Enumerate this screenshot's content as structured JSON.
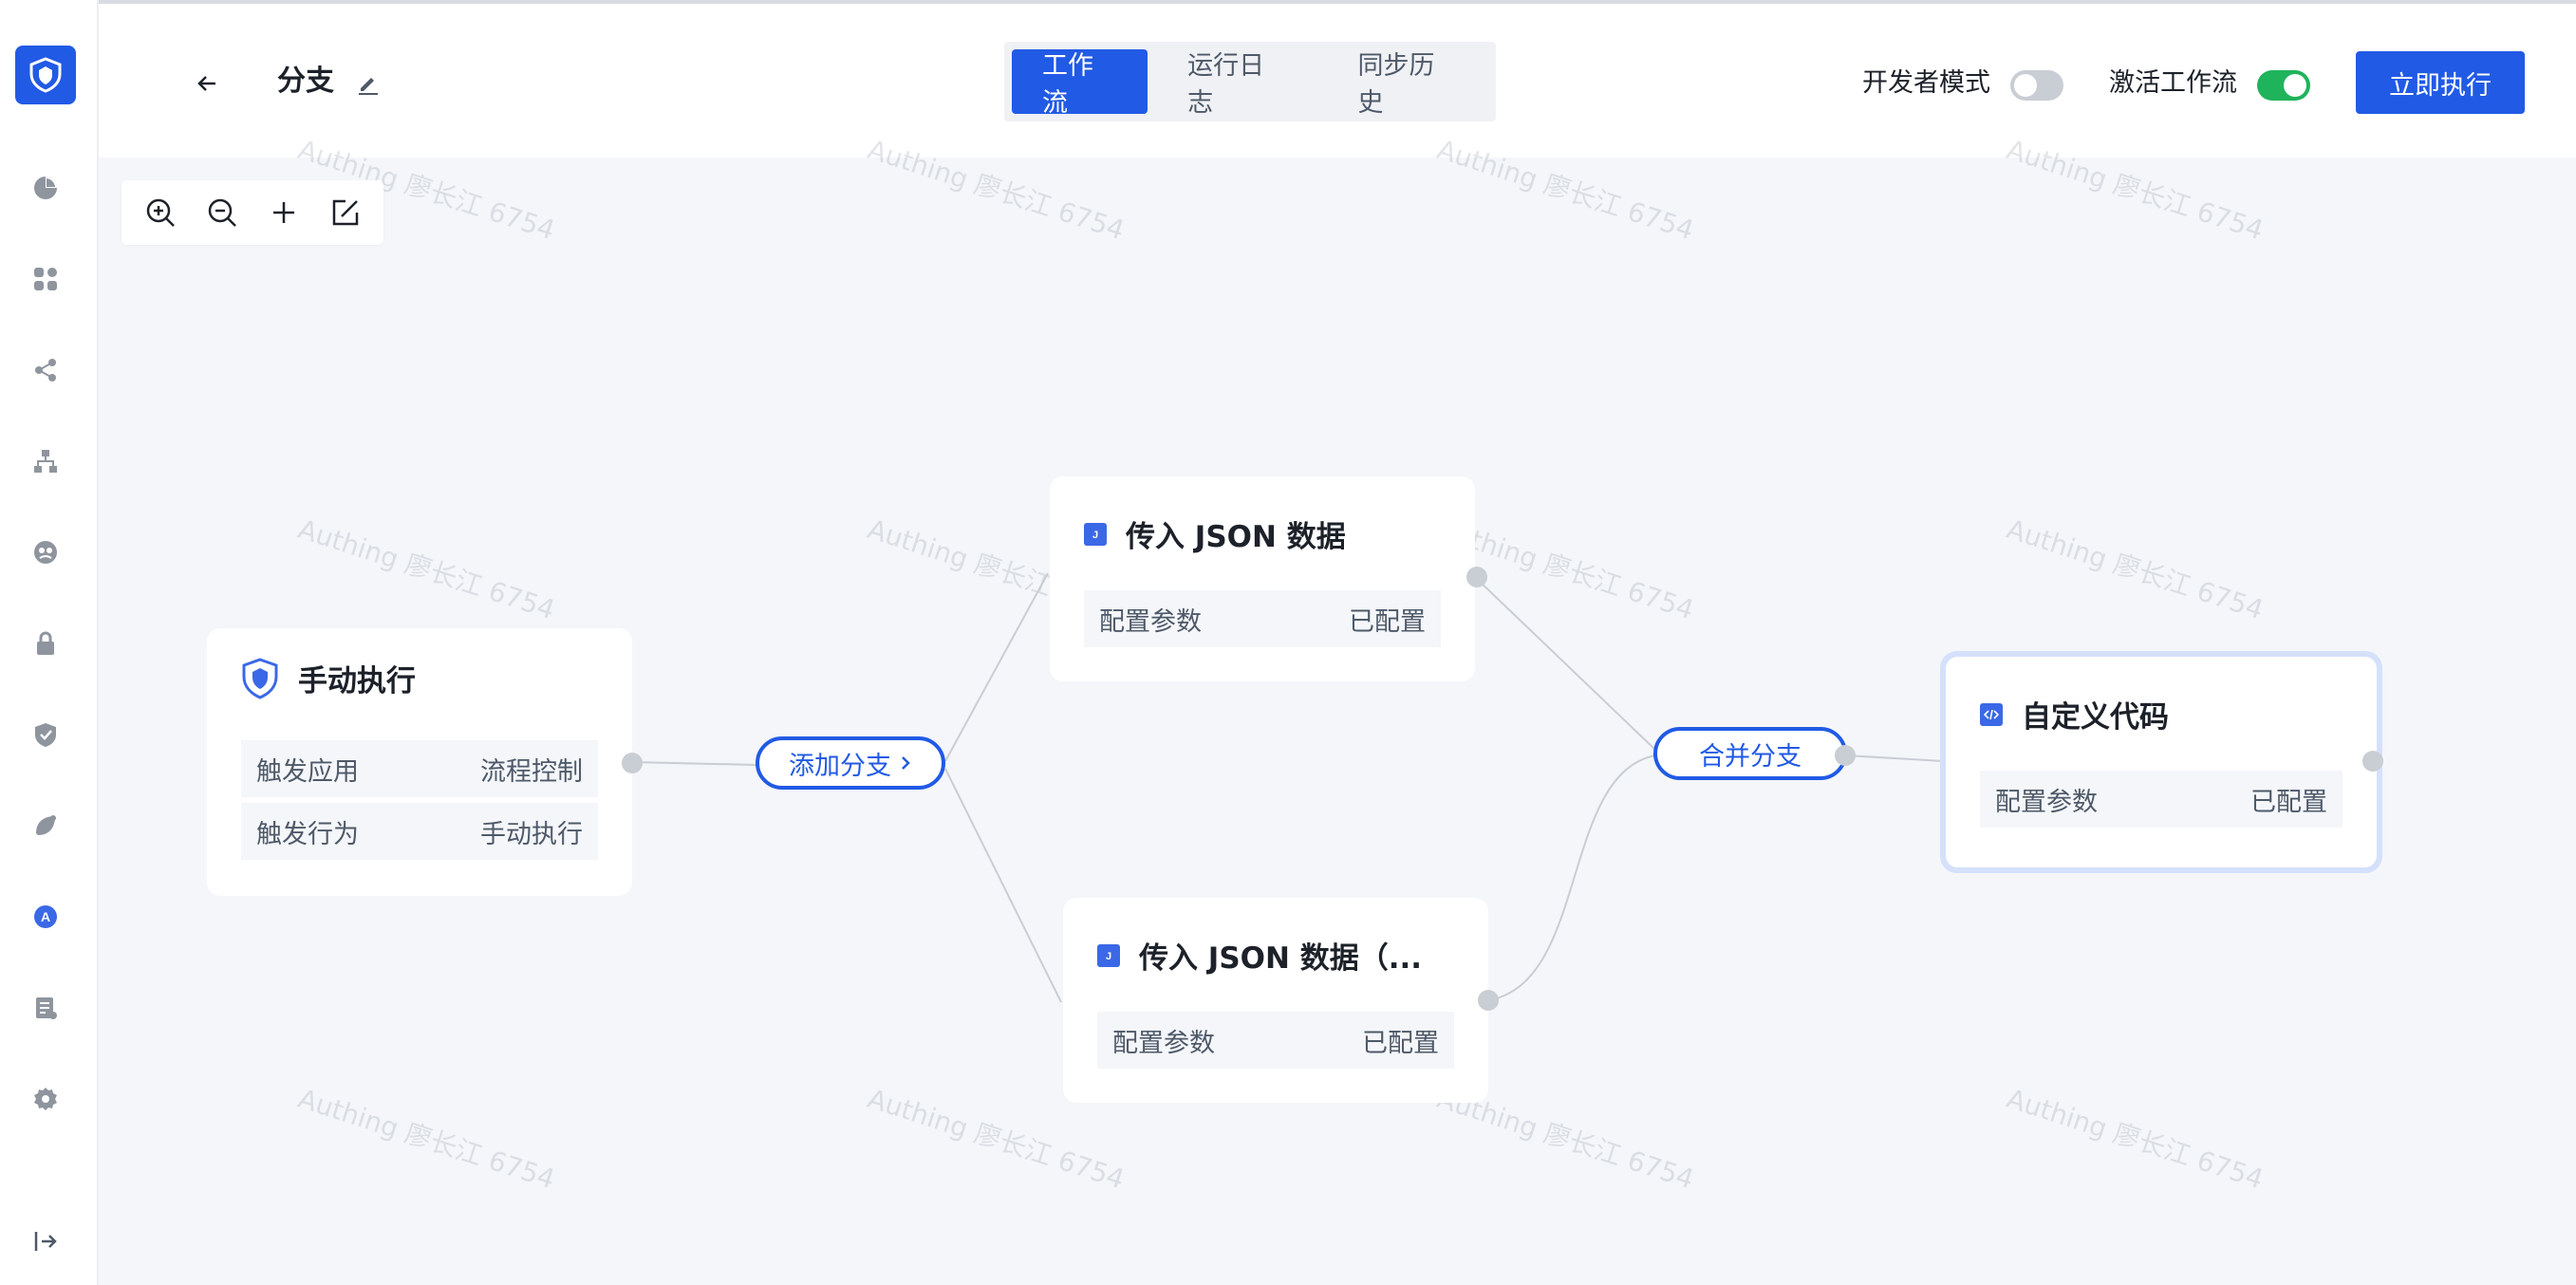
{
  "header": {
    "title": "分支",
    "tabs": [
      "工作流",
      "运行日志",
      "同步历史"
    ],
    "dev_mode_label": "开发者模式",
    "activate_label": "激活工作流",
    "run_label": "立即执行",
    "dev_mode_on": false,
    "activate_on": true
  },
  "sidebar": {
    "icons": [
      "dashboard-icon",
      "apps-icon",
      "share-icon",
      "org-icon",
      "users-icon",
      "lock-icon",
      "shield-check-icon",
      "branding-icon",
      "a-letter-icon",
      "document-icon",
      "settings-icon"
    ]
  },
  "canvas": {
    "watermark": "Authing 廖长江 6754",
    "zoom_tools": [
      "zoom-in-icon",
      "zoom-out-icon",
      "add-icon",
      "edit-square-icon"
    ],
    "nodes": {
      "manual": {
        "title": "手动执行",
        "rows": [
          {
            "label": "触发应用",
            "value": "流程控制"
          },
          {
            "label": "触发行为",
            "value": "手动执行"
          }
        ]
      },
      "json1": {
        "title": "传入 JSON 数据",
        "rows": [
          {
            "label": "配置参数",
            "value": "已配置"
          }
        ]
      },
      "json2": {
        "title": "传入 JSON 数据（...",
        "rows": [
          {
            "label": "配置参数",
            "value": "已配置"
          }
        ]
      },
      "code": {
        "title": "自定义代码",
        "rows": [
          {
            "label": "配置参数",
            "value": "已配置"
          }
        ]
      }
    },
    "add_branch_label": "添加分支",
    "merge_branch_label": "合并分支"
  },
  "colors": {
    "primary": "#215ae5",
    "toggle_on": "#1fb35b",
    "toggle_off": "#c9cdd4"
  }
}
